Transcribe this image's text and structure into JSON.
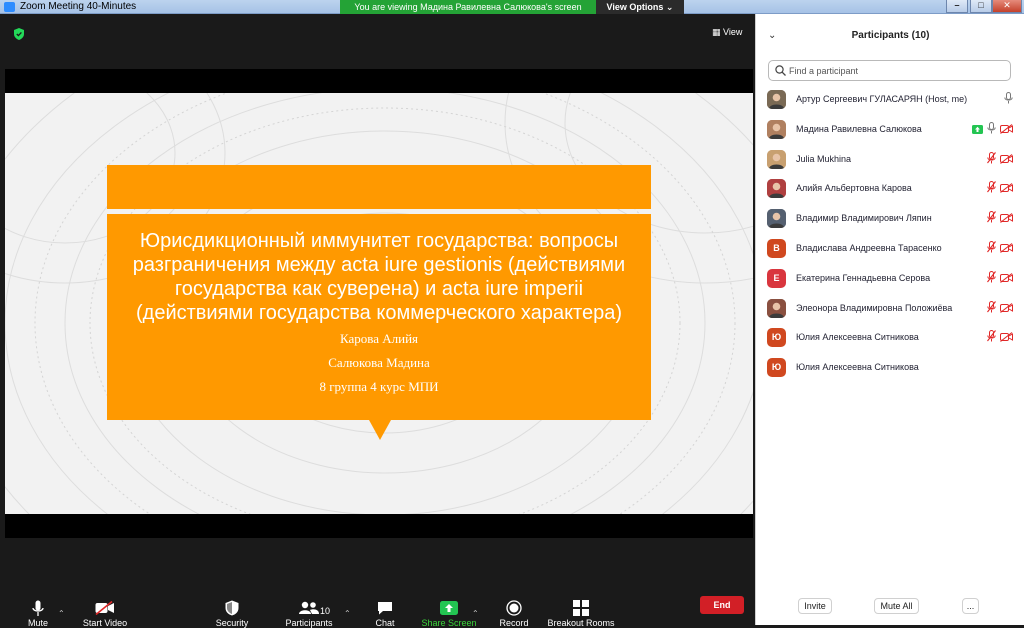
{
  "window": {
    "title": "Zoom Meeting 40-Minutes"
  },
  "banner": {
    "text": "You are viewing Мадина Равилевна Салюкова's screen",
    "view_options": "View Options"
  },
  "meeting": {
    "view_label": "View"
  },
  "slide": {
    "heading": "Юрисдикционный иммунитет государства: вопросы разграничения между acta iure gestionis (действиями государства как суверена) и acta iure imperii (действиями государства коммерческого характера)",
    "author1": "Карова Алийя",
    "author2": "Салюкова Мадина",
    "group": "8 группа 4 курс МПИ",
    "accent_color": "#ff9900"
  },
  "toolbar": {
    "mute": "Mute",
    "start_video": "Start Video",
    "security": "Security",
    "participants": "Participants",
    "participants_count": "10",
    "chat": "Chat",
    "share_screen": "Share Screen",
    "record": "Record",
    "breakout_rooms": "Breakout Rooms",
    "end": "End"
  },
  "panel": {
    "title": "Participants (10)",
    "search_placeholder": "Find a participant",
    "invite": "Invite",
    "mute_all": "Mute All",
    "more": "...",
    "participants": [
      {
        "name": "Артур Сергеевич ГУЛАСАРЯН (Host, me)",
        "avatar": "photo",
        "avatar_color": "#7a6a55",
        "mic_muted": false,
        "video_off": false,
        "sharing": false
      },
      {
        "name": "Мадина Равилевна Салюкова",
        "avatar": "photo",
        "avatar_color": "#b08060",
        "mic_muted": false,
        "video_off": true,
        "sharing": true
      },
      {
        "name": "Julia Mukhina",
        "avatar": "photo",
        "avatar_color": "#c8a070",
        "mic_muted": true,
        "video_off": true,
        "sharing": false
      },
      {
        "name": "Алийя Альбертовна Карова",
        "avatar": "photo",
        "avatar_color": "#b04040",
        "mic_muted": true,
        "video_off": true,
        "sharing": false
      },
      {
        "name": "Владимир Владимирович Ляпин",
        "avatar": "photo",
        "avatar_color": "#556070",
        "mic_muted": true,
        "video_off": true,
        "sharing": false
      },
      {
        "name": "Владислава Андреевна Тарасенко",
        "avatar": "В",
        "avatar_color": "#d0481f",
        "mic_muted": true,
        "video_off": true,
        "sharing": false
      },
      {
        "name": "Екатерина Геннадьевна Серова",
        "avatar": "Е",
        "avatar_color": "#d9363e",
        "mic_muted": true,
        "video_off": true,
        "sharing": false
      },
      {
        "name": "Элеонора Владимировна Положиёва",
        "avatar": "photo",
        "avatar_color": "#8a5040",
        "mic_muted": true,
        "video_off": true,
        "sharing": false
      },
      {
        "name": "Юлия Алексеевна Ситникова",
        "avatar": "Ю",
        "avatar_color": "#d0481f",
        "mic_muted": true,
        "video_off": true,
        "sharing": false
      },
      {
        "name": "Юлия Алексеевна Ситникова",
        "avatar": "Ю",
        "avatar_color": "#d0481f",
        "mic_muted": false,
        "video_off": false,
        "sharing": false
      }
    ]
  }
}
